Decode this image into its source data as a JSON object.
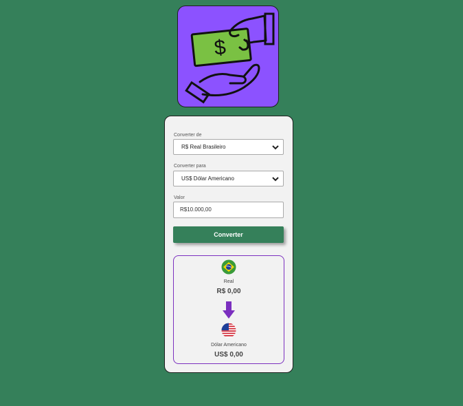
{
  "logo": {
    "icon": "money-exchange-icon",
    "accent": "#8c52ff",
    "bill_color": "#7ac143"
  },
  "form": {
    "from_label": "Converter de",
    "from_value": "R$ Real Brasileiro",
    "to_label": "Converter para",
    "to_value": "US$ Dólar Americano",
    "value_label": "Valor",
    "value_placeholder": "R$10.000,00",
    "button_label": "Converter"
  },
  "result": {
    "from_name": "Real",
    "from_amount": "R$ 0,00",
    "to_name": "Dólar Americano",
    "to_amount": "US$ 0,00",
    "border_color": "#7b2fbf",
    "arrow_color": "#7b2fbf"
  },
  "colors": {
    "background": "#35805a",
    "button": "#35805a"
  }
}
